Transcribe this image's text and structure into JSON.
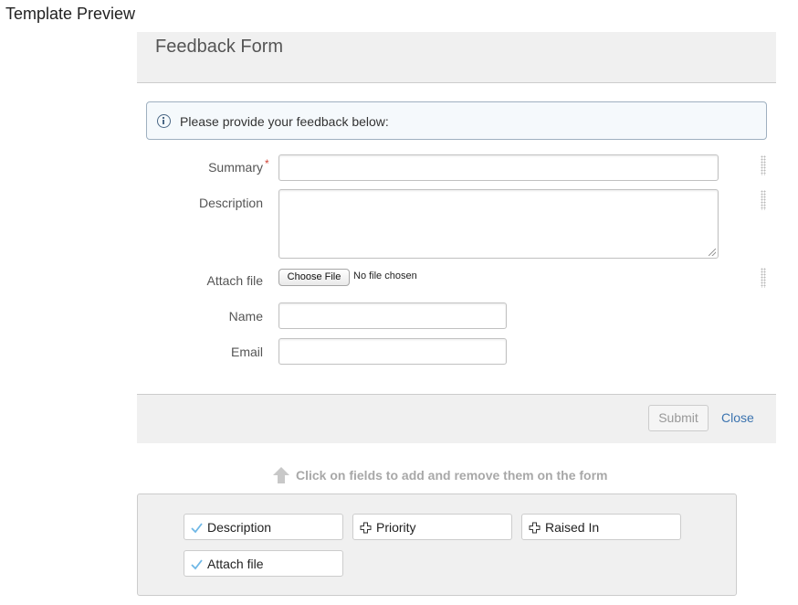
{
  "page": {
    "title": "Template Preview"
  },
  "form": {
    "title": "Feedback Form",
    "info_message": "Please provide your feedback below:",
    "fields": {
      "summary": {
        "label": "Summary",
        "required_marker": "*",
        "value": ""
      },
      "description": {
        "label": "Description",
        "value": ""
      },
      "attach": {
        "label": "Attach file",
        "button_label": "Choose File",
        "status": "No file chosen"
      },
      "name": {
        "label": "Name",
        "value": ""
      },
      "email": {
        "label": "Email",
        "value": ""
      }
    },
    "actions": {
      "submit_label": "Submit",
      "close_label": "Close"
    }
  },
  "field_picker": {
    "hint": "Click on fields to add and remove them on the form",
    "items": [
      {
        "label": "Description",
        "icon": "check-icon",
        "state": "added"
      },
      {
        "label": "Priority",
        "icon": "plus-icon",
        "state": "available"
      },
      {
        "label": "Raised In",
        "icon": "plus-icon",
        "state": "available"
      },
      {
        "label": "Attach file",
        "icon": "check-icon",
        "state": "added"
      }
    ]
  },
  "colors": {
    "header_bg": "#f0f0f0",
    "link": "#3b73af",
    "required": "#d04437",
    "info_border": "#9fb0c0",
    "check": "#6fb8e6"
  }
}
